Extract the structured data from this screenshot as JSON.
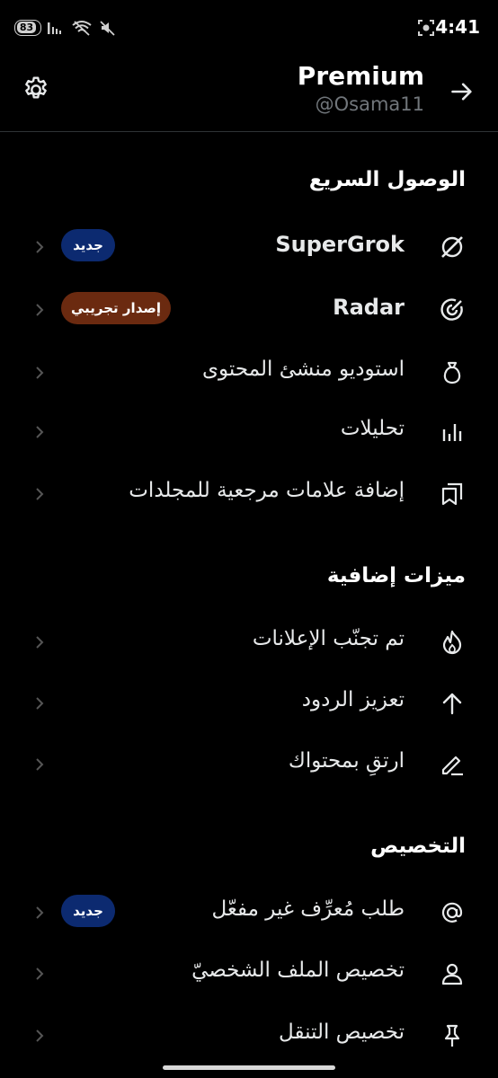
{
  "status_bar": {
    "battery": "83",
    "time": "4:41"
  },
  "header": {
    "title": "Premium",
    "handle": "@Osama11"
  },
  "sections": {
    "quick_access": "الوصول السريع",
    "extra_features": "ميزات إضافية",
    "customization": "التخصيص"
  },
  "quick_access": {
    "supergrok": {
      "label": "SuperGrok",
      "badge": "جديد",
      "icon": "grok-icon"
    },
    "radar": {
      "label": "Radar",
      "badge": "إصدار تجريبي",
      "icon": "radar-icon"
    },
    "creator_studio": {
      "label": "استوديو منشئ المحتوى",
      "icon": "money-bag-icon"
    },
    "analytics": {
      "label": "تحليلات",
      "icon": "analytics-icon"
    },
    "bookmark_folders": {
      "label": "إضافة علامات مرجعية للمجلدات",
      "icon": "bookmarks-icon"
    }
  },
  "extra": {
    "ads_avoided": {
      "label": "تم تجنّب الإعلانات",
      "icon": "flame-icon"
    },
    "reply_boost": {
      "label": "تعزيز الردود",
      "icon": "arrow-up-icon"
    },
    "upgrade_content": {
      "label": "ارتقِ بمحتواك",
      "icon": "pencil-icon"
    }
  },
  "custom": {
    "handle_request": {
      "label": "طلب مُعرِّف غير مفعّل",
      "badge": "جديد",
      "icon": "at-icon"
    },
    "profile_custom": {
      "label": "تخصيص الملف الشخصيّ",
      "icon": "person-icon"
    },
    "nav_custom": {
      "label": "تخصيص التنقل",
      "icon": "pin-icon"
    }
  }
}
